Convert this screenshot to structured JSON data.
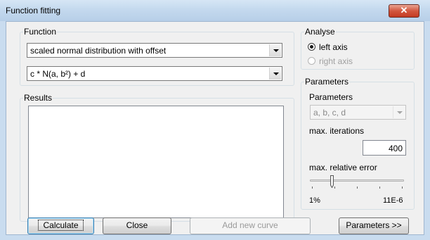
{
  "window": {
    "title": "Function fitting"
  },
  "function_group": {
    "legend": "Function",
    "type_select": "scaled normal distribution with offset",
    "formula_select": "c * N(a, b²) + d"
  },
  "results_group": {
    "legend": "Results"
  },
  "analyse_group": {
    "legend": "Analyse",
    "left_axis": "left axis",
    "right_axis": "right axis",
    "selected": "left axis"
  },
  "parameters_group": {
    "legend": "Parameters",
    "params_label": "Parameters",
    "params_select": "a, b, c, d",
    "max_iterations_label": "max. iterations",
    "max_iterations_value": "400",
    "max_rel_error_label": "max. relative error",
    "slider_min_label": "1%",
    "slider_max_label": "11E-6",
    "slider_position": 0.22
  },
  "buttons": {
    "calculate": "Calculate",
    "close": "Close",
    "add_new_curve": "Add new curve",
    "parameters_more": "Parameters >>"
  },
  "icons": {
    "close": "close-x-icon"
  }
}
